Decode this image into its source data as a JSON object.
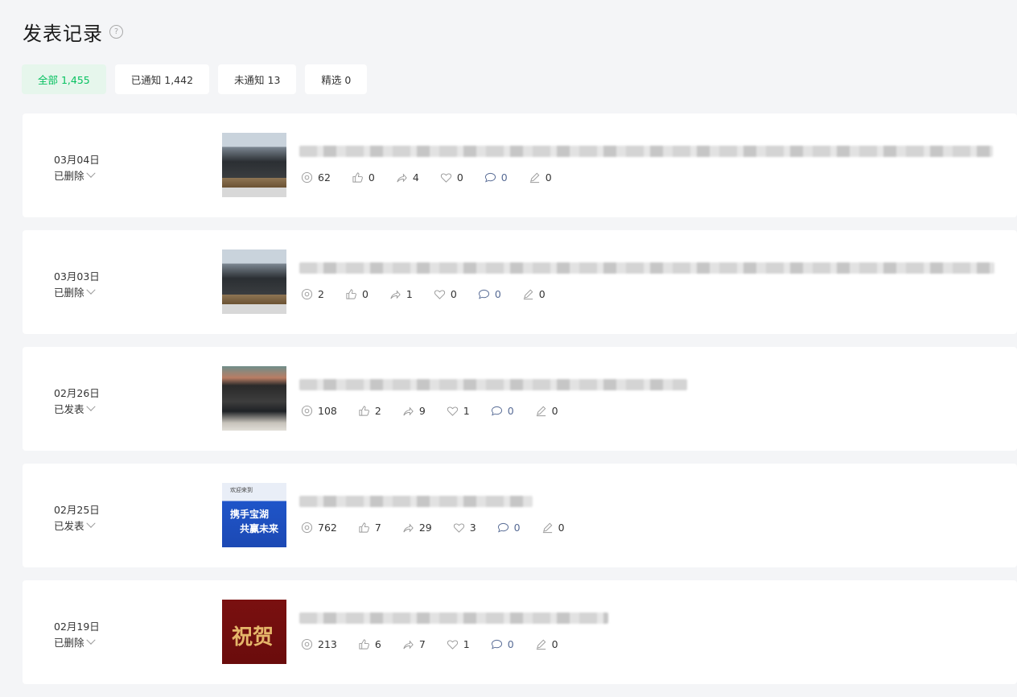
{
  "header": {
    "title": "发表记录",
    "help_icon": "?"
  },
  "filters": [
    {
      "label": "全部 1,455",
      "active": true
    },
    {
      "label": "已通知 1,442",
      "active": false
    },
    {
      "label": "未通知 13",
      "active": false
    },
    {
      "label": "精选 0",
      "active": false
    }
  ],
  "posts": [
    {
      "date": "03月04日",
      "status": "已删除",
      "thumb": "photo",
      "views": "62",
      "likes": "0",
      "shares": "4",
      "favorites": "0",
      "comments": "0",
      "edits": "0"
    },
    {
      "date": "03月03日",
      "status": "已删除",
      "thumb": "photo",
      "views": "2",
      "likes": "0",
      "shares": "1",
      "favorites": "0",
      "comments": "0",
      "edits": "0"
    },
    {
      "date": "02月26日",
      "status": "已发表",
      "thumb": "crowd",
      "views": "108",
      "likes": "2",
      "shares": "9",
      "favorites": "1",
      "comments": "0",
      "edits": "0"
    },
    {
      "date": "02月25日",
      "status": "已发表",
      "thumb": "poster",
      "thumb_text": [
        "欢迎来到",
        "携手宝湖",
        "共赢未来"
      ],
      "views": "762",
      "likes": "7",
      "shares": "29",
      "favorites": "3",
      "comments": "0",
      "edits": "0"
    },
    {
      "date": "02月19日",
      "status": "已删除",
      "thumb": "red",
      "thumb_text": [
        "祝贺"
      ],
      "views": "213",
      "likes": "6",
      "shares": "7",
      "favorites": "1",
      "comments": "0",
      "edits": "0"
    }
  ]
}
